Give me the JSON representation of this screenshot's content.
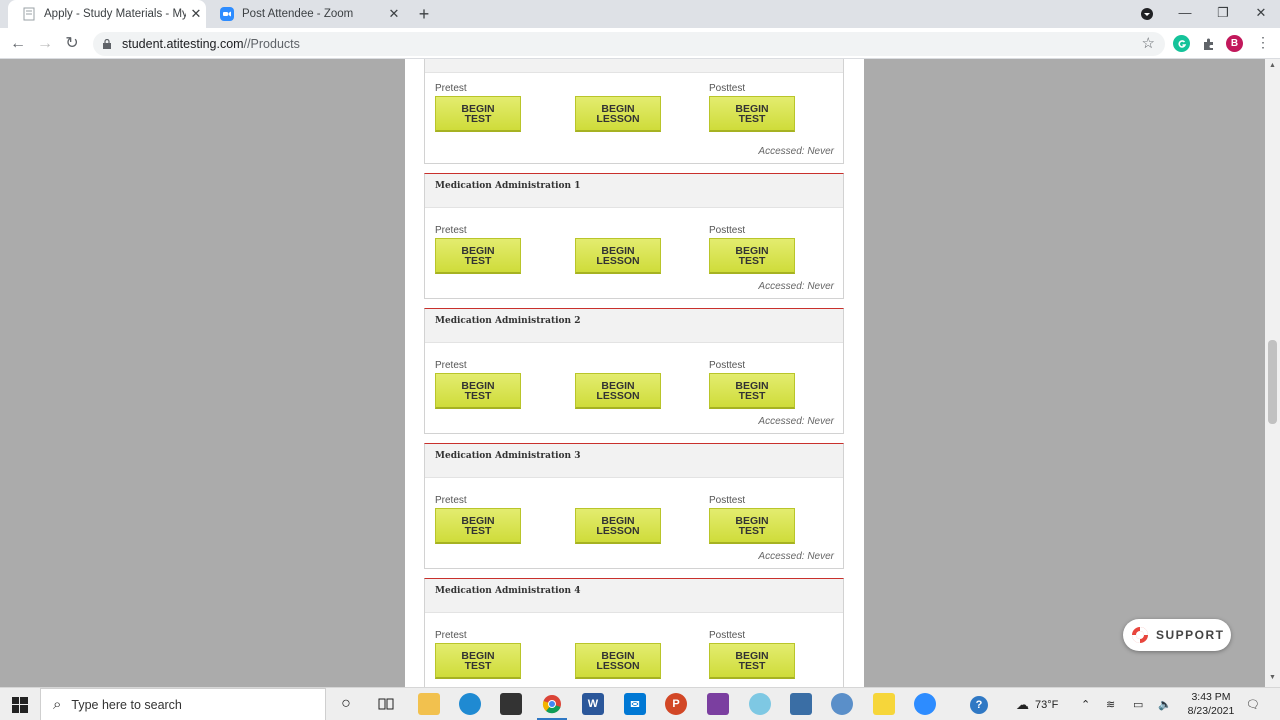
{
  "browser": {
    "tabs": [
      {
        "title": "Apply - Study Materials - My ATI",
        "active": true
      },
      {
        "title": "Post Attendee - Zoom",
        "active": false
      }
    ],
    "url_host": "student.atitesting.com",
    "url_path": "//Products",
    "profile_initial": "B"
  },
  "top_module": {
    "pretest_label": "Pretest",
    "posttest_label": "Posttest",
    "begin_test": "BEGIN\nTEST",
    "begin_lesson": "BEGIN\nLESSON",
    "accessed": "Accessed: Never"
  },
  "modules": [
    {
      "title": "Medication Administration 1",
      "pretest_label": "Pretest",
      "posttest_label": "Posttest",
      "accessed": "Accessed: Never"
    },
    {
      "title": "Medication Administration 2",
      "pretest_label": "Pretest",
      "posttest_label": "Posttest",
      "accessed": "Accessed: Never"
    },
    {
      "title": "Medication Administration 3",
      "pretest_label": "Pretest",
      "posttest_label": "Posttest",
      "accessed": "Accessed: Never"
    },
    {
      "title": "Medication Administration 4",
      "pretest_label": "Pretest",
      "posttest_label": "Posttest",
      "accessed": ""
    }
  ],
  "buttons": {
    "begin_test_line1": "BEGIN",
    "begin_test_line2": "TEST",
    "begin_lesson_line1": "BEGIN",
    "begin_lesson_line2": "LESSON"
  },
  "support_label": "SUPPORT",
  "taskbar": {
    "search_placeholder": "Type here to search",
    "temperature": "73°F",
    "time": "3:43 PM",
    "date": "8/23/2021"
  },
  "colors": {
    "button_fill": "#d6e14a",
    "module_accent": "#c9302c",
    "page_bg": "#ababab"
  }
}
